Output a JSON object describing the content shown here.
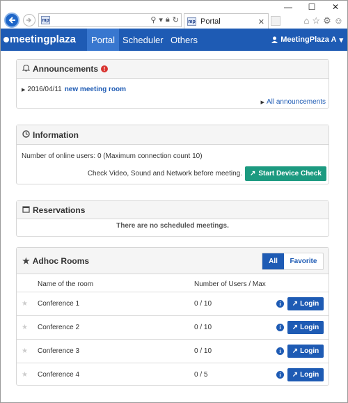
{
  "browser": {
    "tab_title": "Portal",
    "favicon_text": "mp",
    "window_controls": [
      "minimize-icon",
      "maximize-icon",
      "close-icon"
    ]
  },
  "nav": {
    "logo": "meetingplaza",
    "items": [
      {
        "label": "Portal",
        "active": true
      },
      {
        "label": "Scheduler",
        "active": false
      },
      {
        "label": "Others",
        "active": false
      }
    ],
    "user_label": "MeetingPlaza A"
  },
  "announcements": {
    "title": "Announcements",
    "items": [
      {
        "date": "2016/04/11",
        "text": "new meeting room"
      }
    ],
    "all_link": "All announcements"
  },
  "information": {
    "title": "Information",
    "online_users_text": "Number of online users: 0 (Maximum connection count 10)",
    "check_text": "Check Video, Sound and Network before meeting.",
    "check_button": "Start Device Check"
  },
  "reservations": {
    "title": "Reservations",
    "empty_text": "There are no scheduled meetings."
  },
  "adhoc": {
    "title": "Adhoc Rooms",
    "filter_all": "All",
    "filter_favorite": "Favorite",
    "col_name": "Name of the room",
    "col_users": "Number of Users / Max",
    "login_label": "Login",
    "rooms": [
      {
        "name": "Conference 1",
        "users": "0 / 10"
      },
      {
        "name": "Conference 2",
        "users": "0 / 10"
      },
      {
        "name": "Conference 3",
        "users": "0 / 10"
      },
      {
        "name": "Conference 4",
        "users": "0 / 5"
      }
    ]
  },
  "colors": {
    "nav_bg": "#1e5bb4",
    "nav_active": "#3877cf",
    "link": "#1e5bb4",
    "button_green": "#1c9a80",
    "alert_red": "#d9332f"
  }
}
